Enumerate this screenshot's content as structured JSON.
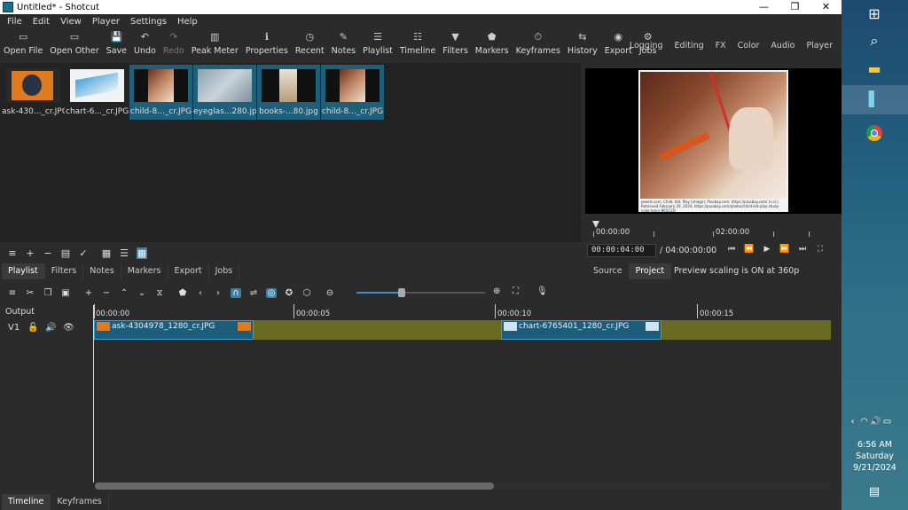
{
  "window": {
    "title": "Untitled* - Shotcut",
    "min": "—",
    "max": "❐",
    "close": "✕"
  },
  "menu": [
    "File",
    "Edit",
    "View",
    "Player",
    "Settings",
    "Help"
  ],
  "toolbar": [
    {
      "label": "Open File",
      "icon": "▭"
    },
    {
      "label": "Open Other",
      "icon": "▭"
    },
    {
      "label": "Save",
      "icon": "💾"
    },
    {
      "label": "Undo",
      "icon": "↶"
    },
    {
      "label": "Redo",
      "icon": "↷"
    },
    {
      "label": "Peak Meter",
      "icon": "▥"
    },
    {
      "label": "Properties",
      "icon": "ℹ"
    },
    {
      "label": "Recent",
      "icon": "◷"
    },
    {
      "label": "Notes",
      "icon": "✎"
    },
    {
      "label": "Playlist",
      "icon": "☰"
    },
    {
      "label": "Timeline",
      "icon": "☷"
    },
    {
      "label": "Filters",
      "icon": "▼"
    },
    {
      "label": "Markers",
      "icon": "⬟"
    },
    {
      "label": "Keyframes",
      "icon": "⏱"
    },
    {
      "label": "History",
      "icon": "⇆"
    },
    {
      "label": "Export",
      "icon": "◉"
    },
    {
      "label": "Jobs",
      "icon": "⚙"
    }
  ],
  "layouts": [
    "Logging",
    "Editing",
    "FX",
    "Color",
    "Audio",
    "Player"
  ],
  "playlist": {
    "items": [
      {
        "caption": "ask-430..._cr.JPG",
        "selected": false
      },
      {
        "caption": "chart-6..._cr.JPG",
        "selected": false
      },
      {
        "caption": "child-8..._cr.JPG",
        "selected": true
      },
      {
        "caption": "eyeglas...280.jpg",
        "selected": true
      },
      {
        "caption": "books-...80.jpg",
        "selected": true
      },
      {
        "caption": "child-8..._cr.JPG",
        "selected": true
      }
    ],
    "tabs": [
      "Playlist",
      "Filters",
      "Notes",
      "Markers",
      "Export",
      "Jobs"
    ]
  },
  "viewer": {
    "credit": "pexels.com. Child, Kid, Play [image]. Pixabay.com. https://pixabay.com/ (n.d.). Retrieved February 29, 2024, https://pixabay.com/photos/child-kid-play-study-color-learn-865116/",
    "ruler": [
      "00:00:00",
      "02:00:00"
    ],
    "timecode": "00:00:04:00",
    "duration": "/ 04:00:00:00",
    "tabs": [
      "Source",
      "Project"
    ],
    "scaling": "Preview scaling is ON at 360p"
  },
  "timeline": {
    "output_label": "Output",
    "track_name": "V1",
    "ruler": [
      "00:00:00",
      "00:00:05",
      "00:00:10",
      "00:00:15"
    ],
    "clips": [
      "ask-4304978_1280_cr.JPG",
      "chart-6765401_1280_cr.JPG"
    ],
    "tabs": [
      "Timeline",
      "Keyframes"
    ]
  },
  "taskbar": {
    "time": "6:56 AM",
    "day": "Saturday",
    "date": "9/21/2024"
  }
}
